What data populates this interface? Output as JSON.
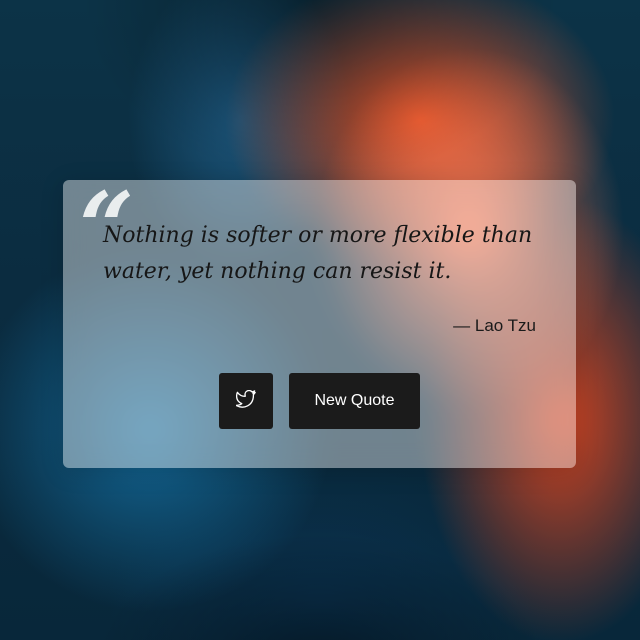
{
  "quote": {
    "open_mark": "“",
    "text": "Nothing is softer or more flexible than water, yet nothing can resist it.",
    "author": "— Lao Tzu"
  },
  "actions": {
    "tweet_icon": "twitter-bird-icon",
    "new_quote_label": "New Quote"
  },
  "colors": {
    "button_bg": "#1b1b1b",
    "button_text": "#ffffff",
    "text_dark": "#161616"
  }
}
